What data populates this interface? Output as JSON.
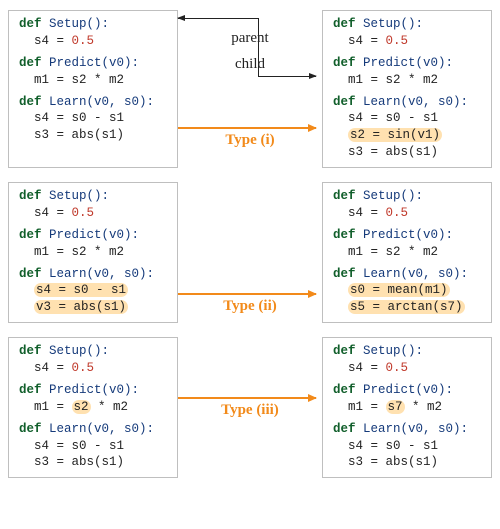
{
  "labels": {
    "parent": "parent",
    "child": "child",
    "type1": "Type (i)",
    "type2": "Type (ii)",
    "type3": "Type (iii)"
  },
  "kw": {
    "def": "def"
  },
  "rows": [
    {
      "left": {
        "setup": {
          "sig": "Setup():",
          "body": [
            "s4 = ",
            "0.5"
          ]
        },
        "predict": {
          "sig": "Predict(v0):",
          "body": [
            "m1 = s2 * m2"
          ]
        },
        "learn": {
          "sig": "Learn(v0, s0):",
          "body": [
            "s4 = s0 - s1",
            "s3 = abs(s1)"
          ]
        }
      },
      "right": {
        "setup": {
          "sig": "Setup():",
          "body": [
            "s4 = ",
            "0.5"
          ]
        },
        "predict": {
          "sig": "Predict(v0):",
          "body": [
            "m1 = s2 * m2"
          ]
        },
        "learn": {
          "sig": "Learn(v0, s0):",
          "body": [
            "s4 = s0 - s1",
            "s2 = sin(v1)",
            "s3 = abs(s1)"
          ]
        },
        "hl_lines": [
          1
        ]
      }
    },
    {
      "left": {
        "setup": {
          "sig": "Setup():",
          "body": [
            "s4 = ",
            "0.5"
          ]
        },
        "predict": {
          "sig": "Predict(v0):",
          "body": [
            "m1 = s2 * m2"
          ]
        },
        "learn": {
          "sig": "Learn(v0, s0):",
          "body": [
            "s4 = s0 - s1",
            "v3 = abs(s1)"
          ]
        },
        "hl_lines": [
          0,
          1
        ]
      },
      "right": {
        "setup": {
          "sig": "Setup():",
          "body": [
            "s4 = ",
            "0.5"
          ]
        },
        "predict": {
          "sig": "Predict(v0):",
          "body": [
            "m1 = s2 * m2"
          ]
        },
        "learn": {
          "sig": "Learn(v0, s0):",
          "body": [
            "s0 = mean(m1)",
            "s5 = arctan(s7)"
          ]
        },
        "hl_lines": [
          0,
          1
        ]
      }
    },
    {
      "left": {
        "setup": {
          "sig": "Setup():",
          "body": [
            "s4 = ",
            "0.5"
          ]
        },
        "predict": {
          "sig": "Predict(v0):",
          "body_hl": {
            "pre": "m1 = ",
            "hl": "s2",
            "post": " * m2"
          }
        },
        "learn": {
          "sig": "Learn(v0, s0):",
          "body": [
            "s4 = s0 - s1",
            "s3 = abs(s1)"
          ]
        }
      },
      "right": {
        "setup": {
          "sig": "Setup():",
          "body": [
            "s4 = ",
            "0.5"
          ]
        },
        "predict": {
          "sig": "Predict(v0):",
          "body_hl": {
            "pre": "m1 = ",
            "hl": "s7",
            "post": " * m2"
          }
        },
        "learn": {
          "sig": "Learn(v0, s0):",
          "body": [
            "s4 = s0 - s1",
            "s3 = abs(s1)"
          ]
        }
      }
    }
  ]
}
